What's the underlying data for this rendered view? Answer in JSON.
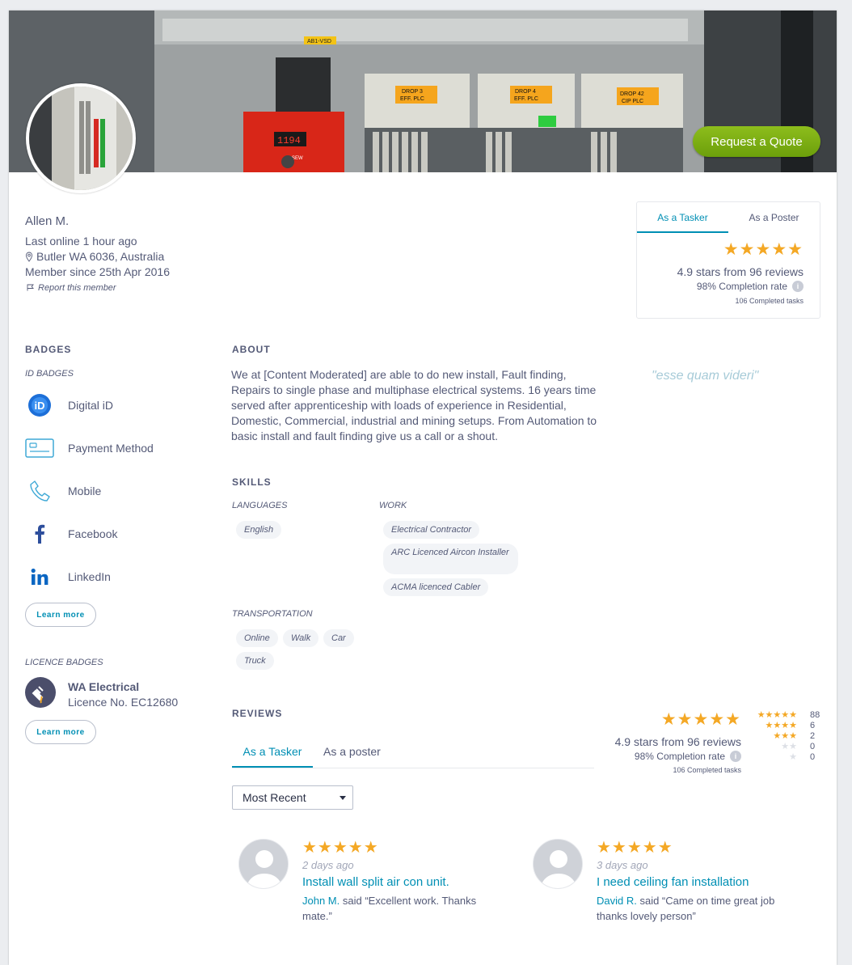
{
  "header": {
    "cta_label": "Request a Quote",
    "cover_labels": [
      "AB1-VSD",
      "DROP 3",
      "EFF. PLC",
      "DROP 4",
      "EFF. PLC",
      "DROP 42",
      "CIP PLC",
      "SEW"
    ],
    "cover_readout": "1194"
  },
  "member": {
    "name": "Allen M.",
    "last_online": "Last online 1 hour ago",
    "location": "Butler WA 6036, Australia",
    "member_since": "Member since 25th Apr 2016",
    "report": "Report this member"
  },
  "stats": {
    "tabs": [
      "As a Tasker",
      "As a Poster"
    ],
    "stars": "★★★★★",
    "rating_text": "4.9 stars from 96 reviews",
    "completion_pct": "98%",
    "completion_label": "Completion rate",
    "completed_tasks": "106 Completed tasks"
  },
  "badges": {
    "title": "BADGES",
    "id_title": "ID BADGES",
    "id_items": [
      {
        "label": "Digital iD",
        "icon": "digital-id-icon"
      },
      {
        "label": "Payment Method",
        "icon": "card-icon"
      },
      {
        "label": "Mobile",
        "icon": "phone-icon"
      },
      {
        "label": "Facebook",
        "icon": "facebook-icon"
      },
      {
        "label": "LinkedIn",
        "icon": "linkedin-icon"
      }
    ],
    "learn_more": "Learn more",
    "licence_title": "LICENCE BADGES",
    "licence_name": "WA Electrical",
    "licence_number": "Licence No. EC12680"
  },
  "about": {
    "title": "ABOUT",
    "text": "We at [Content Moderated] are able to do new install, Fault finding, Repairs to single phase and multiphase electrical systems. 16 years time served after apprenticeship with loads of experience in Residential, Domestic, Commercial, industrial and mining setups. From Automation to basic install and fault finding give us a call or a shout.",
    "quote": "\"esse quam videri\""
  },
  "skills": {
    "title": "SKILLS",
    "languages_title": "LANGUAGES",
    "languages": [
      "English"
    ],
    "work_title": "WORK",
    "work": [
      "Electrical Contractor",
      "ARC Licenced Aircon Installer",
      "ACMA licenced Cabler"
    ],
    "transport_title": "TRANSPORTATION",
    "transport": [
      "Online",
      "Walk",
      "Car",
      "Truck"
    ]
  },
  "reviews": {
    "title": "REVIEWS",
    "tabs": [
      "As a Tasker",
      "As a poster"
    ],
    "stars": "★★★★★",
    "rating_text": "4.9 stars from 96 reviews",
    "completion_pct": "98%",
    "completion_label": "Completion rate",
    "completed_tasks": "106 Completed tasks",
    "distribution": [
      {
        "stars": "★★★★★",
        "count": "88"
      },
      {
        "stars": "★★★★",
        "count": "6"
      },
      {
        "stars": "★★★",
        "count": "2"
      },
      {
        "stars": "★★",
        "count": "0"
      },
      {
        "stars": "★",
        "count": "0"
      }
    ],
    "sort_value": "Most Recent",
    "items": [
      {
        "stars": "★★★★★",
        "when": "2 days ago",
        "title": "Install wall split air con unit.",
        "author": "John M.",
        "text": " said “Excellent work. Thanks mate.”"
      },
      {
        "stars": "★★★★★",
        "when": "3 days ago",
        "title": "I need ceiling fan installation",
        "author": "David R.",
        "text": " said “Came on time great job thanks lovely person”"
      }
    ]
  },
  "colors": {
    "accent": "#008fb4",
    "star": "#f4a825",
    "cta": "#7cb014",
    "text": "#545a77"
  }
}
